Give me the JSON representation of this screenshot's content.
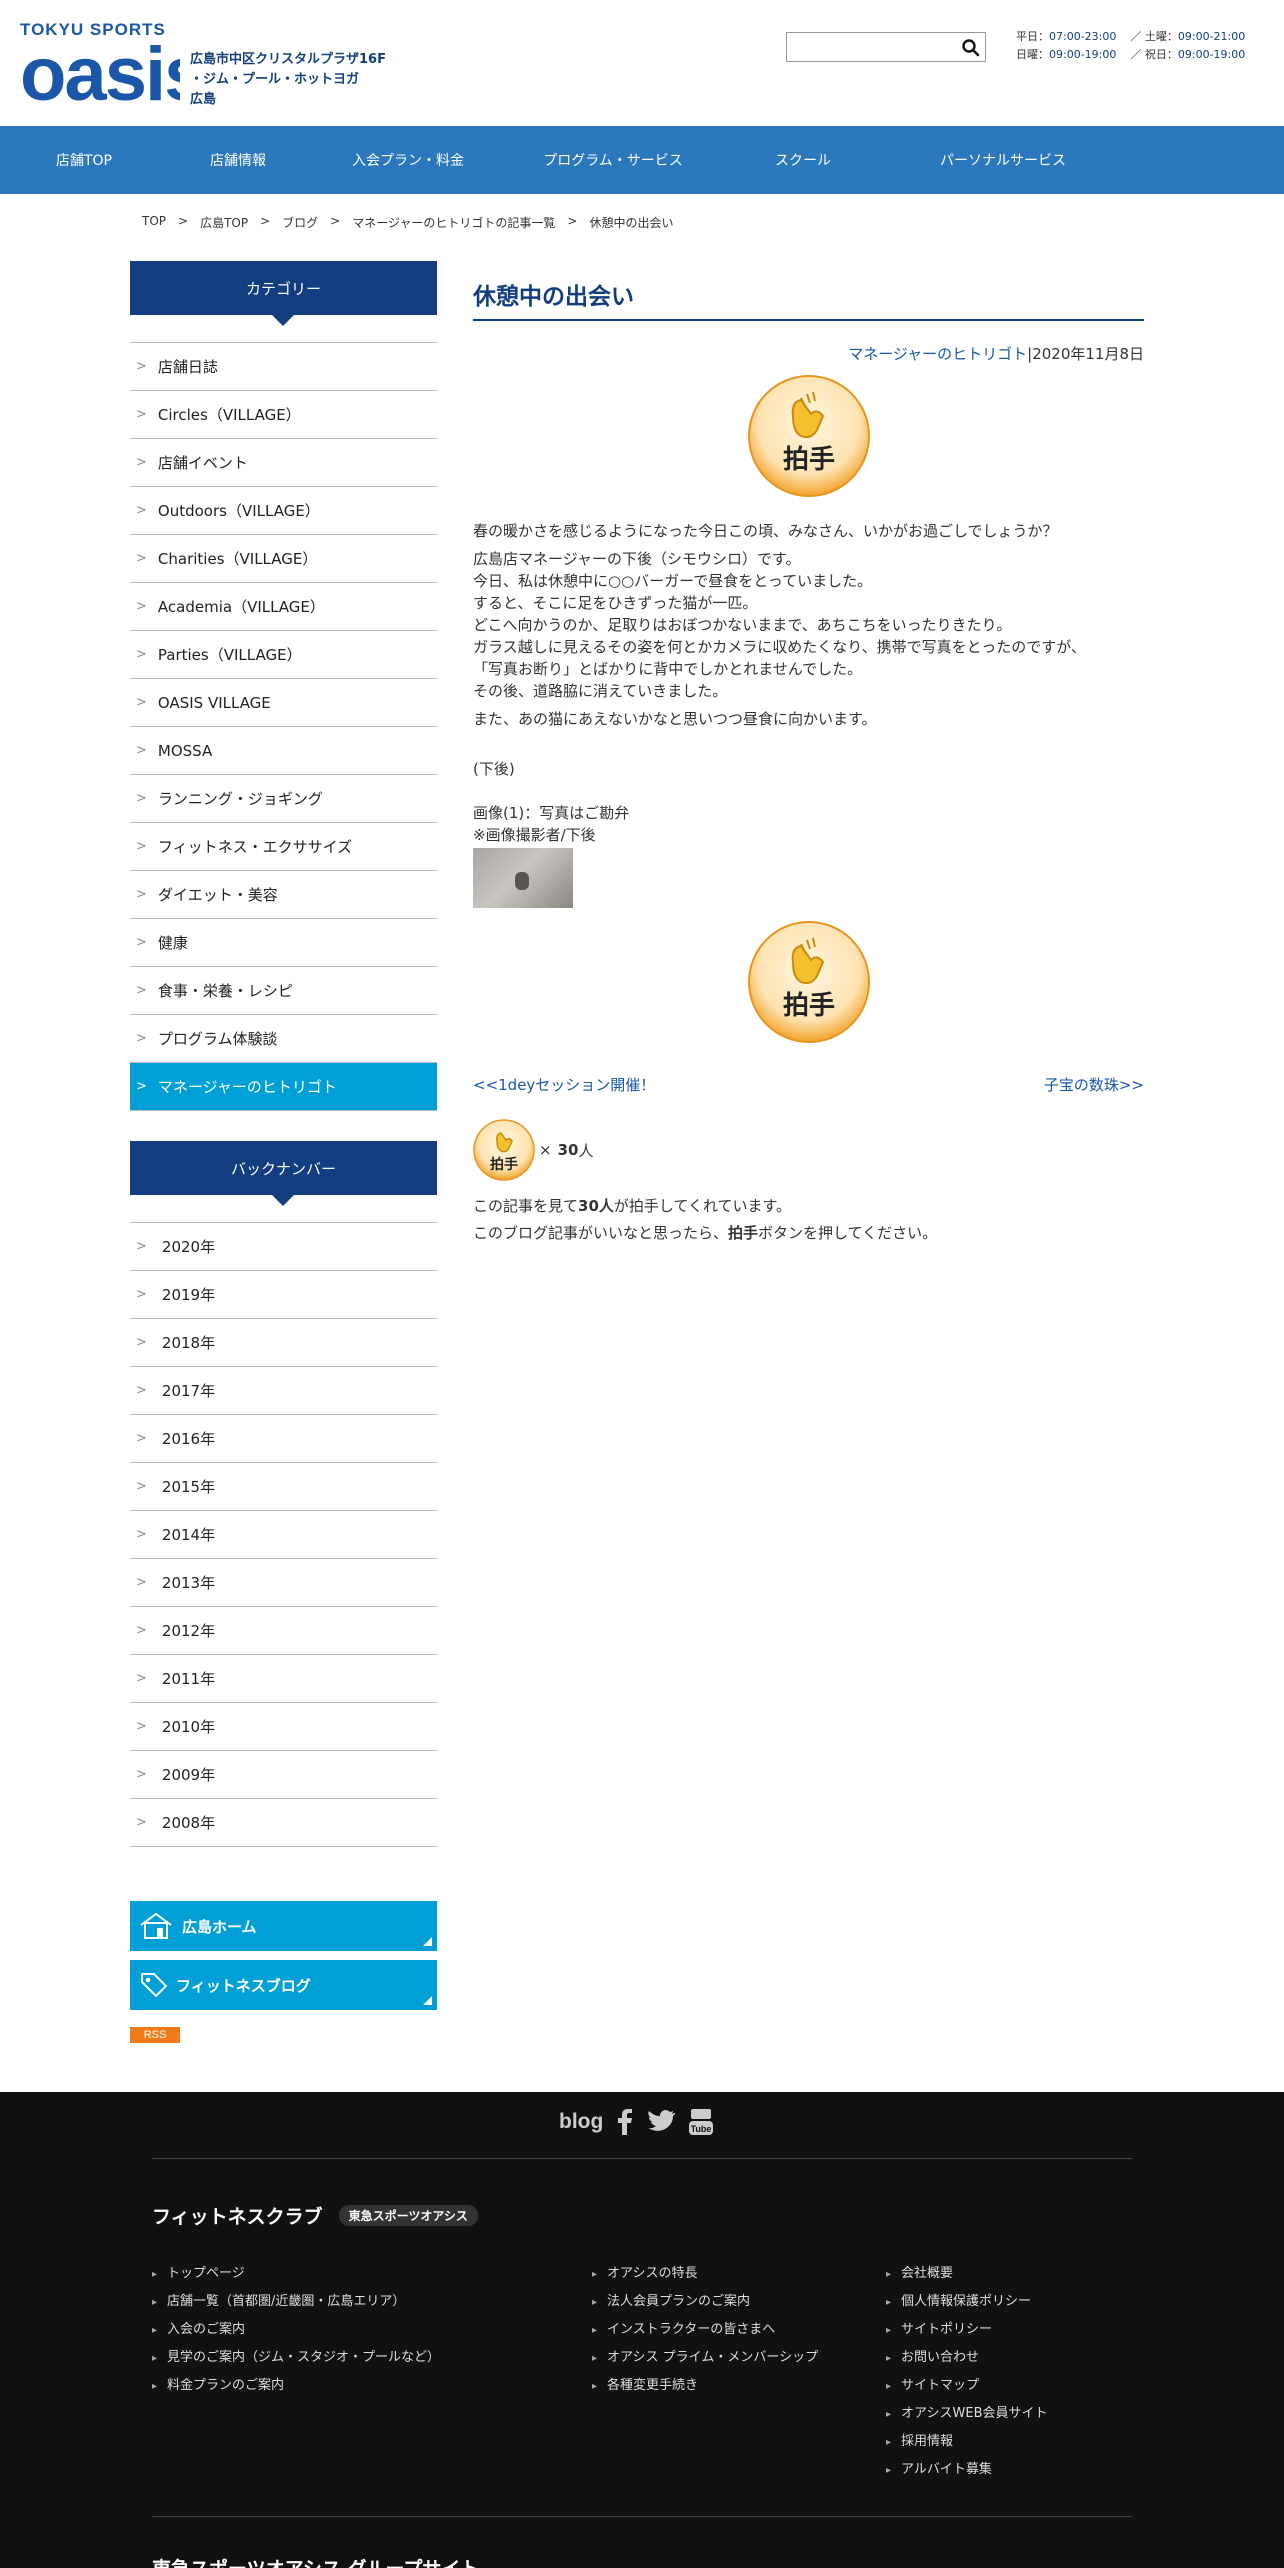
{
  "header": {
    "brand_top": "TOKYU SPORTS",
    "brand_word": "oasis",
    "store_lines": [
      "広島市中区クリスタルプラザ16F",
      "・ジム・プール・ホットヨガ",
      "広島"
    ],
    "search": {
      "value": "",
      "placeholder": ""
    },
    "hours": {
      "weekday_label": "平日：",
      "weekday": "07:00-23:00",
      "sat_label": "／ 土曜：",
      "sat": "09:00-21:00",
      "sun_label": "日曜：",
      "sun": "09:00-19:00",
      "hol_label": "／ 祝日：",
      "hol": "09:00-19:00"
    }
  },
  "nav": [
    "店舗TOP",
    "店舗情報",
    "入会プラン・料金",
    "プログラム・サービス",
    "スクール",
    "パーソナルサービス"
  ],
  "breadcrumb": [
    "TOP",
    "広島TOP",
    "ブログ",
    "マネージャーのヒトリゴトの記事一覧",
    "休憩中の出会い"
  ],
  "breadcrumb_sep": ">",
  "sidebar": {
    "category_title": "カテゴリー",
    "categories": [
      "店舗日誌",
      "Circles（VILLAGE）",
      "店舗イベント",
      "Outdoors（VILLAGE）",
      "Charities（VILLAGE）",
      "Academia（VILLAGE）",
      "Parties（VILLAGE）",
      "OASIS VILLAGE",
      "MOSSA",
      "ランニング・ジョギング",
      "フィットネス・エクササイズ",
      "ダイエット・美容",
      "健康",
      "食事・栄養・レシピ",
      "プログラム体験談",
      "マネージャーのヒトリゴト"
    ],
    "active_category": "マネージャーのヒトリゴト",
    "backnumber_title": "バックナンバー",
    "years": [
      "2020年",
      "2019年",
      "2018年",
      "2017年",
      "2016年",
      "2015年",
      "2014年",
      "2013年",
      "2012年",
      "2011年",
      "2010年",
      "2009年",
      "2008年"
    ],
    "chevron": ">",
    "home_button": "広島ホーム",
    "blog_button": "フィットネスブログ",
    "rss": "RSS"
  },
  "article": {
    "title": "休憩中の出会い",
    "author": "マネージャーのヒトリゴト",
    "date": "|2020年11月8日",
    "clap_label": "拍手",
    "intro": "春の暖かさを感じるようになった今日この頃、みなさん、いかがお過ごしでしょうか？",
    "paragraph": [
      "広島店マネージャーの下後（シモウシロ）です。",
      "今日、私は休憩中に○○バーガーで昼食をとっていました。",
      "すると、そこに足をひきずった猫が一匹。",
      "どこへ向かうのか、足取りはおぼつかないままで、あちこちをいったりきたり。",
      "ガラス越しに見えるその姿を何とかカメラに収めたくなり、携帯で写真をとったのですが、",
      "「写真お断り」とばかりに背中でしかとれませんでした。",
      "その後、道路脇に消えていきました。"
    ],
    "closing": "また、あの猫にあえないかなと思いつつ昼食に向かいます。",
    "signature": "(下後)",
    "caption1": "画像(1)：写真はご勘弁",
    "caption2": "※画像撮影者/下後",
    "prev_link": "<<1deyセッション開催！",
    "next_link": "子宝の数珠>>",
    "count_times": "×",
    "count_value": "30",
    "count_unit": "人",
    "note1_a": "この記事を見て",
    "note1_b": "30人",
    "note1_c": "が拍手してくれています。",
    "note2_a": "このブログ記事がいいなと思ったら、",
    "note2_b": "拍手",
    "note2_c": "ボタンを押してください。"
  },
  "footer": {
    "blog": "blog",
    "title": "フィットネスクラブ",
    "badge": "東急スポーツオアシス",
    "col1": [
      "トップページ",
      "店舗一覧（首都圏/近畿圏・広島エリア）",
      "入会のご案内",
      "見学のご案内（ジム・スタジオ・プールなど）",
      "料金プランのご案内"
    ],
    "col2": [
      "オアシスの特長",
      "法人会員プランのご案内",
      "インストラクターの皆さまへ",
      "オアシス プライム・メンバーシップ",
      "各種変更手続き"
    ],
    "col3": [
      "会社概要",
      "個人情報保護ポリシー",
      "サイトポリシー",
      "お問い合わせ",
      "サイトマップ",
      "オアシスWEB会員サイト",
      "採用情報",
      "アルバイト募集"
    ],
    "bottom": "東急スポーツオアシス グループサイト"
  },
  "colors": {
    "brand_blue": "#1a57a8",
    "nav_blue": "#2b78bd",
    "dark_navy": "#123e80",
    "cyan": "#00a0d6",
    "clap_orange": "#f2a32a"
  }
}
